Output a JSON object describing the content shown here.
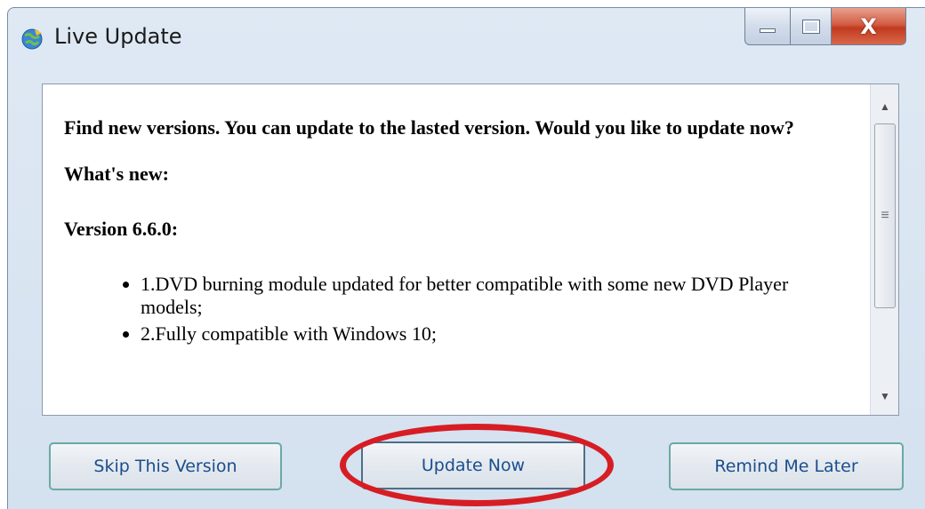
{
  "window": {
    "title": "Live Update",
    "icon": "globe-update-icon",
    "controls": {
      "minimize_icon": "minimize-icon",
      "maximize_icon": "maximize-icon",
      "close_glyph": "X"
    }
  },
  "content": {
    "intro": "Find new versions. You can update to the lasted version. Would you like to update now?",
    "whats_new": "What's new:",
    "version": "Version 6.6.0:",
    "changes": [
      "1.DVD burning module updated for better compatible with some new DVD Player models;",
      "2.Fully compatible with Windows 10;"
    ]
  },
  "scrollbar": {
    "grip": "≡"
  },
  "buttons": {
    "skip": "Skip This Version",
    "update": "Update Now",
    "remind": "Remind Me Later"
  },
  "colors": {
    "highlight": "#d71d24",
    "button_text": "#1a4e8c",
    "button_border": "#6aa9a6"
  }
}
